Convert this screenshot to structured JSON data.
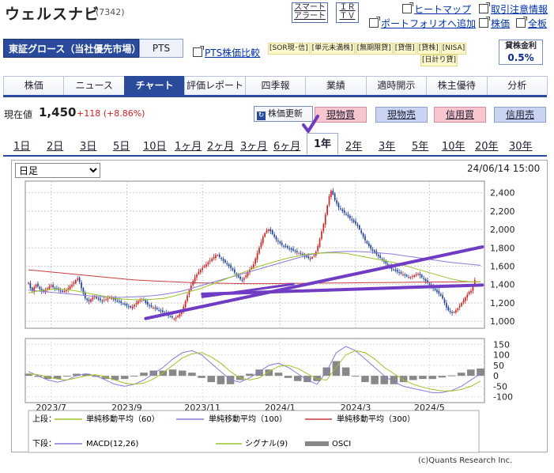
{
  "header": {
    "title": "ウェルスナビ",
    "code": "(7342)",
    "smart_alert": [
      "スマート",
      "アラート"
    ],
    "ir_tv": [
      "ＩＲ",
      "ＴＶ"
    ],
    "links": {
      "heatmap": "ヒートマップ",
      "restriction": "取引注意情報",
      "portfolio": "ポートフォリオへ追加",
      "stockprice": "株価",
      "fullboard": "全板"
    }
  },
  "market": {
    "name": "東証グロース（当社優先市場）",
    "pts": "PTS",
    "pts_compare": "PTS株価比較",
    "tags": [
      "SOR現･信",
      "単元未満株",
      "無期限貸",
      "貸借",
      "貸株",
      "NISA",
      "日計り貸"
    ],
    "kinri_label": "貸株金利",
    "kinri_value": "0.5%"
  },
  "nav": [
    "株価",
    "ニュース",
    "チャート",
    "評価レポート",
    "四季報",
    "業績",
    "適時開示",
    "株主優待",
    "分析"
  ],
  "quote": {
    "label": "現在値",
    "price": "1,450",
    "change": "+118 (+8.86%)",
    "update_button": "株価更新",
    "buttons": [
      "現物買",
      "現物売",
      "信用買",
      "信用売"
    ]
  },
  "periods": [
    "1日",
    "2日",
    "3日",
    "5日",
    "10日",
    "1ヶ月",
    "2ヶ月",
    "3ヶ月",
    "6ヶ月",
    "1年",
    "2年",
    "3年",
    "5年",
    "10年",
    "20年",
    "30年"
  ],
  "period_active": "1年",
  "chart_controls": {
    "interval": "日足",
    "datetime": "24/06/14 15:00"
  },
  "legend": {
    "upper_label": "上段：",
    "lower_label": "下段：",
    "upper": [
      "単純移動平均（60）",
      "単純移動平均（100）",
      "単純移動平均（300）"
    ],
    "lower": [
      "MACD(12,26)",
      "シグナル(9)",
      "OSCI"
    ]
  },
  "credit": "(c)Quants Research Inc.",
  "colors": {
    "brand": "#2a4a9c",
    "up": "#d02020",
    "down": "#1f3f9e",
    "sma60": "#9bc42a",
    "sma100": "#8e7ad6",
    "sma300": "#c43d3d",
    "annotation": "#6f3cc3"
  },
  "chart_data": {
    "type": "candlestick",
    "x_ticks": [
      "2023/7",
      "2023/9",
      "2023/11",
      "2024/1",
      "2024/3",
      "2024/5"
    ],
    "y_ticks": [
      "2,400",
      "2,200",
      "2,000",
      "1,800",
      "1,600",
      "1,400",
      "1,200",
      "1,000"
    ],
    "y_range": [
      950,
      2500
    ],
    "x_count": 240,
    "tick_index": [
      12,
      52,
      92,
      133,
      173,
      212
    ],
    "closes": [
      1420,
      1360,
      1330,
      1370,
      1400,
      1380,
      1350,
      1330,
      1320,
      1340,
      1360,
      1380,
      1390,
      1370,
      1360,
      1350,
      1340,
      1330,
      1320,
      1330,
      1340,
      1360,
      1380,
      1400,
      1420,
      1450,
      1470,
      1430,
      1360,
      1300,
      1250,
      1230,
      1220,
      1240,
      1260,
      1270,
      1250,
      1240,
      1230,
      1220,
      1230,
      1240,
      1250,
      1260,
      1250,
      1240,
      1230,
      1220,
      1210,
      1200,
      1190,
      1180,
      1170,
      1160,
      1150,
      1160,
      1180,
      1200,
      1220,
      1230,
      1240,
      1230,
      1200,
      1180,
      1170,
      1160,
      1150,
      1140,
      1130,
      1120,
      1110,
      1100,
      1090,
      1080,
      1060,
      1050,
      1040,
      1030,
      1040,
      1060,
      1080,
      1110,
      1160,
      1220,
      1280,
      1340,
      1390,
      1440,
      1480,
      1510,
      1540,
      1560,
      1580,
      1600,
      1620,
      1640,
      1660,
      1680,
      1700,
      1720,
      1720,
      1700,
      1680,
      1660,
      1640,
      1620,
      1600,
      1580,
      1560,
      1530,
      1500,
      1480,
      1460,
      1450,
      1470,
      1500,
      1530,
      1560,
      1590,
      1620,
      1680,
      1740,
      1800,
      1860,
      1920,
      1960,
      1990,
      2000,
      1980,
      1950,
      1920,
      1890,
      1870,
      1850,
      1830,
      1820,
      1810,
      1800,
      1790,
      1780,
      1770,
      1760,
      1750,
      1740,
      1730,
      1720,
      1710,
      1700,
      1690,
      1680,
      1700,
      1720,
      1760,
      1820,
      1900,
      1980,
      2060,
      2160,
      2260,
      2360,
      2420,
      2380,
      2320,
      2280,
      2240,
      2220,
      2200,
      2180,
      2160,
      2140,
      2120,
      2100,
      2080,
      2060,
      2040,
      2000,
      1960,
      1920,
      1880,
      1850,
      1820,
      1790,
      1770,
      1750,
      1730,
      1710,
      1690,
      1670,
      1650,
      1630,
      1610,
      1590,
      1570,
      1560,
      1550,
      1540,
      1530,
      1520,
      1510,
      1500,
      1490,
      1480,
      1480,
      1490,
      1500,
      1510,
      1520,
      1500,
      1480,
      1460,
      1440,
      1420,
      1400,
      1380,
      1360,
      1340,
      1320,
      1300,
      1280,
      1250,
      1200,
      1150,
      1120,
      1100,
      1090,
      1100,
      1120,
      1140,
      1170,
      1200,
      1230,
      1260,
      1290,
      1320,
      1332,
      1380,
      1450
    ],
    "sma60": [
      1310,
      1330,
      1345,
      1350,
      1345,
      1330,
      1310,
      1290,
      1270,
      1250,
      1240,
      1235,
      1235,
      1240,
      1250,
      1270,
      1300,
      1330,
      1360,
      1400,
      1440,
      1480,
      1520,
      1560,
      1600,
      1630,
      1660,
      1690,
      1710,
      1730,
      1740,
      1745,
      1745,
      1740,
      1720,
      1700,
      1680,
      1660,
      1640,
      1610,
      1580,
      1550,
      1520,
      1490,
      1460,
      1440,
      1430,
      1430
    ],
    "sma100": [
      1340,
      1330,
      1320,
      1310,
      1300,
      1290,
      1280,
      1270,
      1265,
      1260,
      1262,
      1266,
      1272,
      1280,
      1292,
      1310,
      1330,
      1360,
      1390,
      1420,
      1450,
      1480,
      1510,
      1540,
      1570,
      1600,
      1630,
      1660,
      1690,
      1720,
      1740,
      1750,
      1755,
      1760,
      1760,
      1755,
      1750,
      1740,
      1730,
      1715,
      1700,
      1685,
      1670,
      1655,
      1640,
      1630,
      1620,
      1610
    ],
    "sma300": [
      1560,
      1550,
      1540,
      1530,
      1520,
      1510,
      1500,
      1490,
      1480,
      1470,
      1460,
      1450,
      1445,
      1440,
      1435,
      1430,
      1425,
      1420,
      1418,
      1416,
      1414,
      1412,
      1410,
      1410,
      1410,
      1410,
      1411,
      1412,
      1413,
      1414,
      1415,
      1416,
      1417,
      1418,
      1419,
      1420,
      1421,
      1422,
      1423,
      1424,
      1425,
      1426,
      1427,
      1428,
      1429,
      1430,
      1430,
      1430
    ],
    "macd": [
      20,
      0,
      -20,
      -30,
      -20,
      0,
      10,
      0,
      -20,
      -40,
      -50,
      -40,
      -20,
      10,
      40,
      80,
      110,
      120,
      100,
      60,
      20,
      -20,
      -30,
      -10,
      20,
      50,
      60,
      40,
      10,
      -20,
      -40,
      20,
      110,
      140,
      120,
      80,
      40,
      0,
      -30,
      -50,
      -60,
      -70,
      -80,
      -80,
      -70,
      -50,
      -20,
      10
    ],
    "signal": [
      10,
      5,
      -5,
      -15,
      -20,
      -10,
      0,
      5,
      -5,
      -20,
      -35,
      -40,
      -35,
      -15,
      15,
      50,
      85,
      105,
      110,
      90,
      60,
      20,
      -10,
      -20,
      -10,
      20,
      45,
      50,
      35,
      10,
      -15,
      -20,
      40,
      100,
      120,
      110,
      80,
      40,
      10,
      -20,
      -40,
      -55,
      -65,
      -72,
      -72,
      -65,
      -50,
      -25
    ],
    "macd_range": [
      -120,
      170
    ],
    "macd_ticks": [
      "150",
      "100",
      "50",
      "0",
      "-50",
      "-100"
    ],
    "annotations": {
      "lines": 3,
      "checkmark": true
    }
  }
}
